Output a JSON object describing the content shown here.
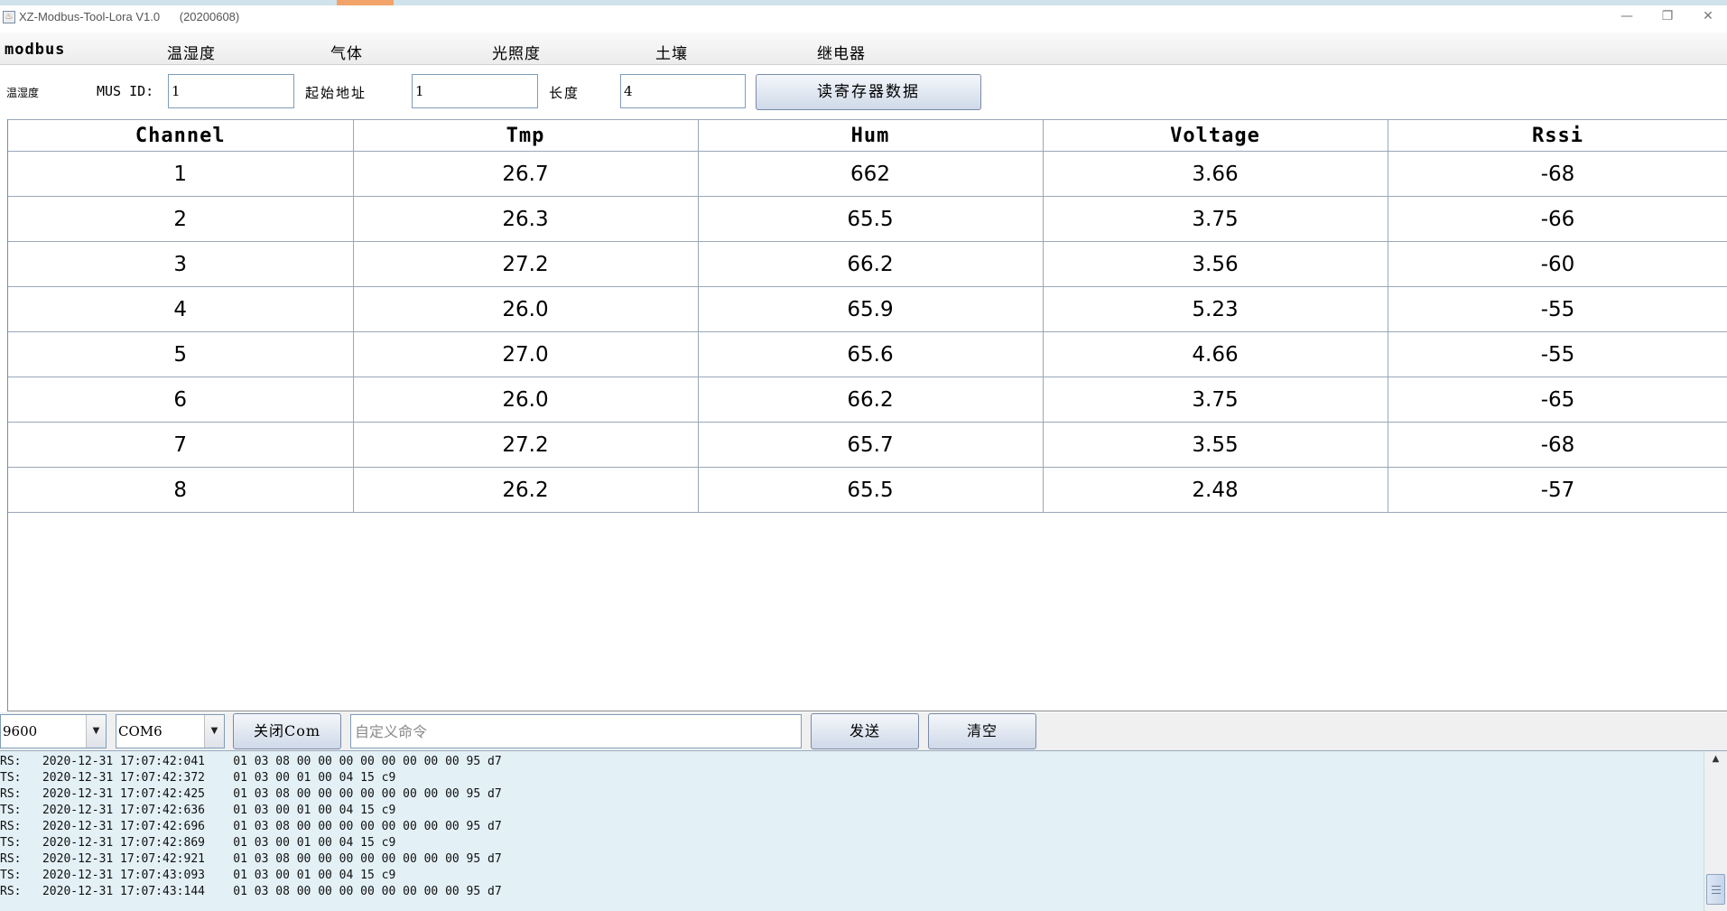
{
  "window": {
    "title": "XZ-Modbus-Tool-Lora V1.0      (20200608)",
    "app_icon": "java-cup-icon",
    "minimize_glyph": "—",
    "restore_glyph": "❐",
    "close_glyph": "✕"
  },
  "menu": {
    "items": [
      {
        "label": "modbus"
      },
      {
        "label": "温湿度"
      },
      {
        "label": "气体"
      },
      {
        "label": "光照度"
      },
      {
        "label": "土壤"
      },
      {
        "label": "继电器"
      }
    ]
  },
  "params": {
    "section_label": "温湿度",
    "mus_id_label": "MUS ID:",
    "mus_id_value": "1",
    "start_addr_label": "起始地址",
    "start_addr_value": "1",
    "length_label": "长度",
    "length_value": "4",
    "read_button": "读寄存器数据"
  },
  "table": {
    "columns": [
      "Channel",
      "Tmp",
      "Hum",
      "Voltage",
      "Rssi"
    ],
    "rows": [
      [
        "1",
        "26.7",
        "662",
        "3.66",
        "-68"
      ],
      [
        "2",
        "26.3",
        "65.5",
        "3.75",
        "-66"
      ],
      [
        "3",
        "27.2",
        "66.2",
        "3.56",
        "-60"
      ],
      [
        "4",
        "26.0",
        "65.9",
        "5.23",
        "-55"
      ],
      [
        "5",
        "27.0",
        "65.6",
        "4.66",
        "-55"
      ],
      [
        "6",
        "26.0",
        "66.2",
        "3.75",
        "-65"
      ],
      [
        "7",
        "27.2",
        "65.7",
        "3.55",
        "-68"
      ],
      [
        "8",
        "26.2",
        "65.5",
        "2.48",
        "-57"
      ]
    ]
  },
  "bottom": {
    "baud_value": "9600",
    "port_value": "COM6",
    "close_com_button": "关闭Com",
    "custom_cmd_placeholder": "自定义命令",
    "send_button": "发送",
    "clear_button": "清空",
    "dropdown_glyph": "▼"
  },
  "log": {
    "lines": [
      "RS:   2020-12-31 17:07:42:041    01 03 08 00 00 00 00 00 00 00 00 95 d7",
      "TS:   2020-12-31 17:07:42:372    01 03 00 01 00 04 15 c9",
      "RS:   2020-12-31 17:07:42:425    01 03 08 00 00 00 00 00 00 00 00 95 d7",
      "TS:   2020-12-31 17:07:42:636    01 03 00 01 00 04 15 c9",
      "RS:   2020-12-31 17:07:42:696    01 03 08 00 00 00 00 00 00 00 00 95 d7",
      "TS:   2020-12-31 17:07:42:869    01 03 00 01 00 04 15 c9",
      "RS:   2020-12-31 17:07:42:921    01 03 08 00 00 00 00 00 00 00 00 95 d7",
      "TS:   2020-12-31 17:07:43:093    01 03 00 01 00 04 15 c9",
      "RS:   2020-12-31 17:07:43:144    01 03 08 00 00 00 00 00 00 00 00 95 d7"
    ],
    "scroll_up_glyph": "▲"
  }
}
